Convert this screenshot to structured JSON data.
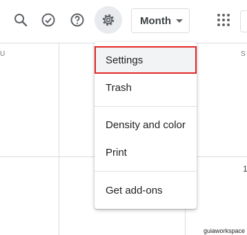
{
  "toolbar": {
    "search_icon": "search-icon",
    "tasks_icon": "check-circle-icon",
    "help_icon": "help-icon",
    "settings_icon": "gear-icon",
    "view_select": "Month",
    "apps_icon": "apps-grid-icon"
  },
  "calendar": {
    "day_labels": [
      "U",
      "S"
    ],
    "day_numbers": [
      "1"
    ]
  },
  "menu": {
    "items": [
      {
        "label": "Settings",
        "selected": true
      },
      {
        "label": "Trash"
      },
      {
        "label": "Density and color"
      },
      {
        "label": "Print"
      },
      {
        "label": "Get add-ons"
      }
    ]
  },
  "watermark": "guiaworkspace",
  "colors": {
    "highlight_border": "#e32525",
    "icon_gray": "#5f6368",
    "divider": "#dadce0"
  }
}
